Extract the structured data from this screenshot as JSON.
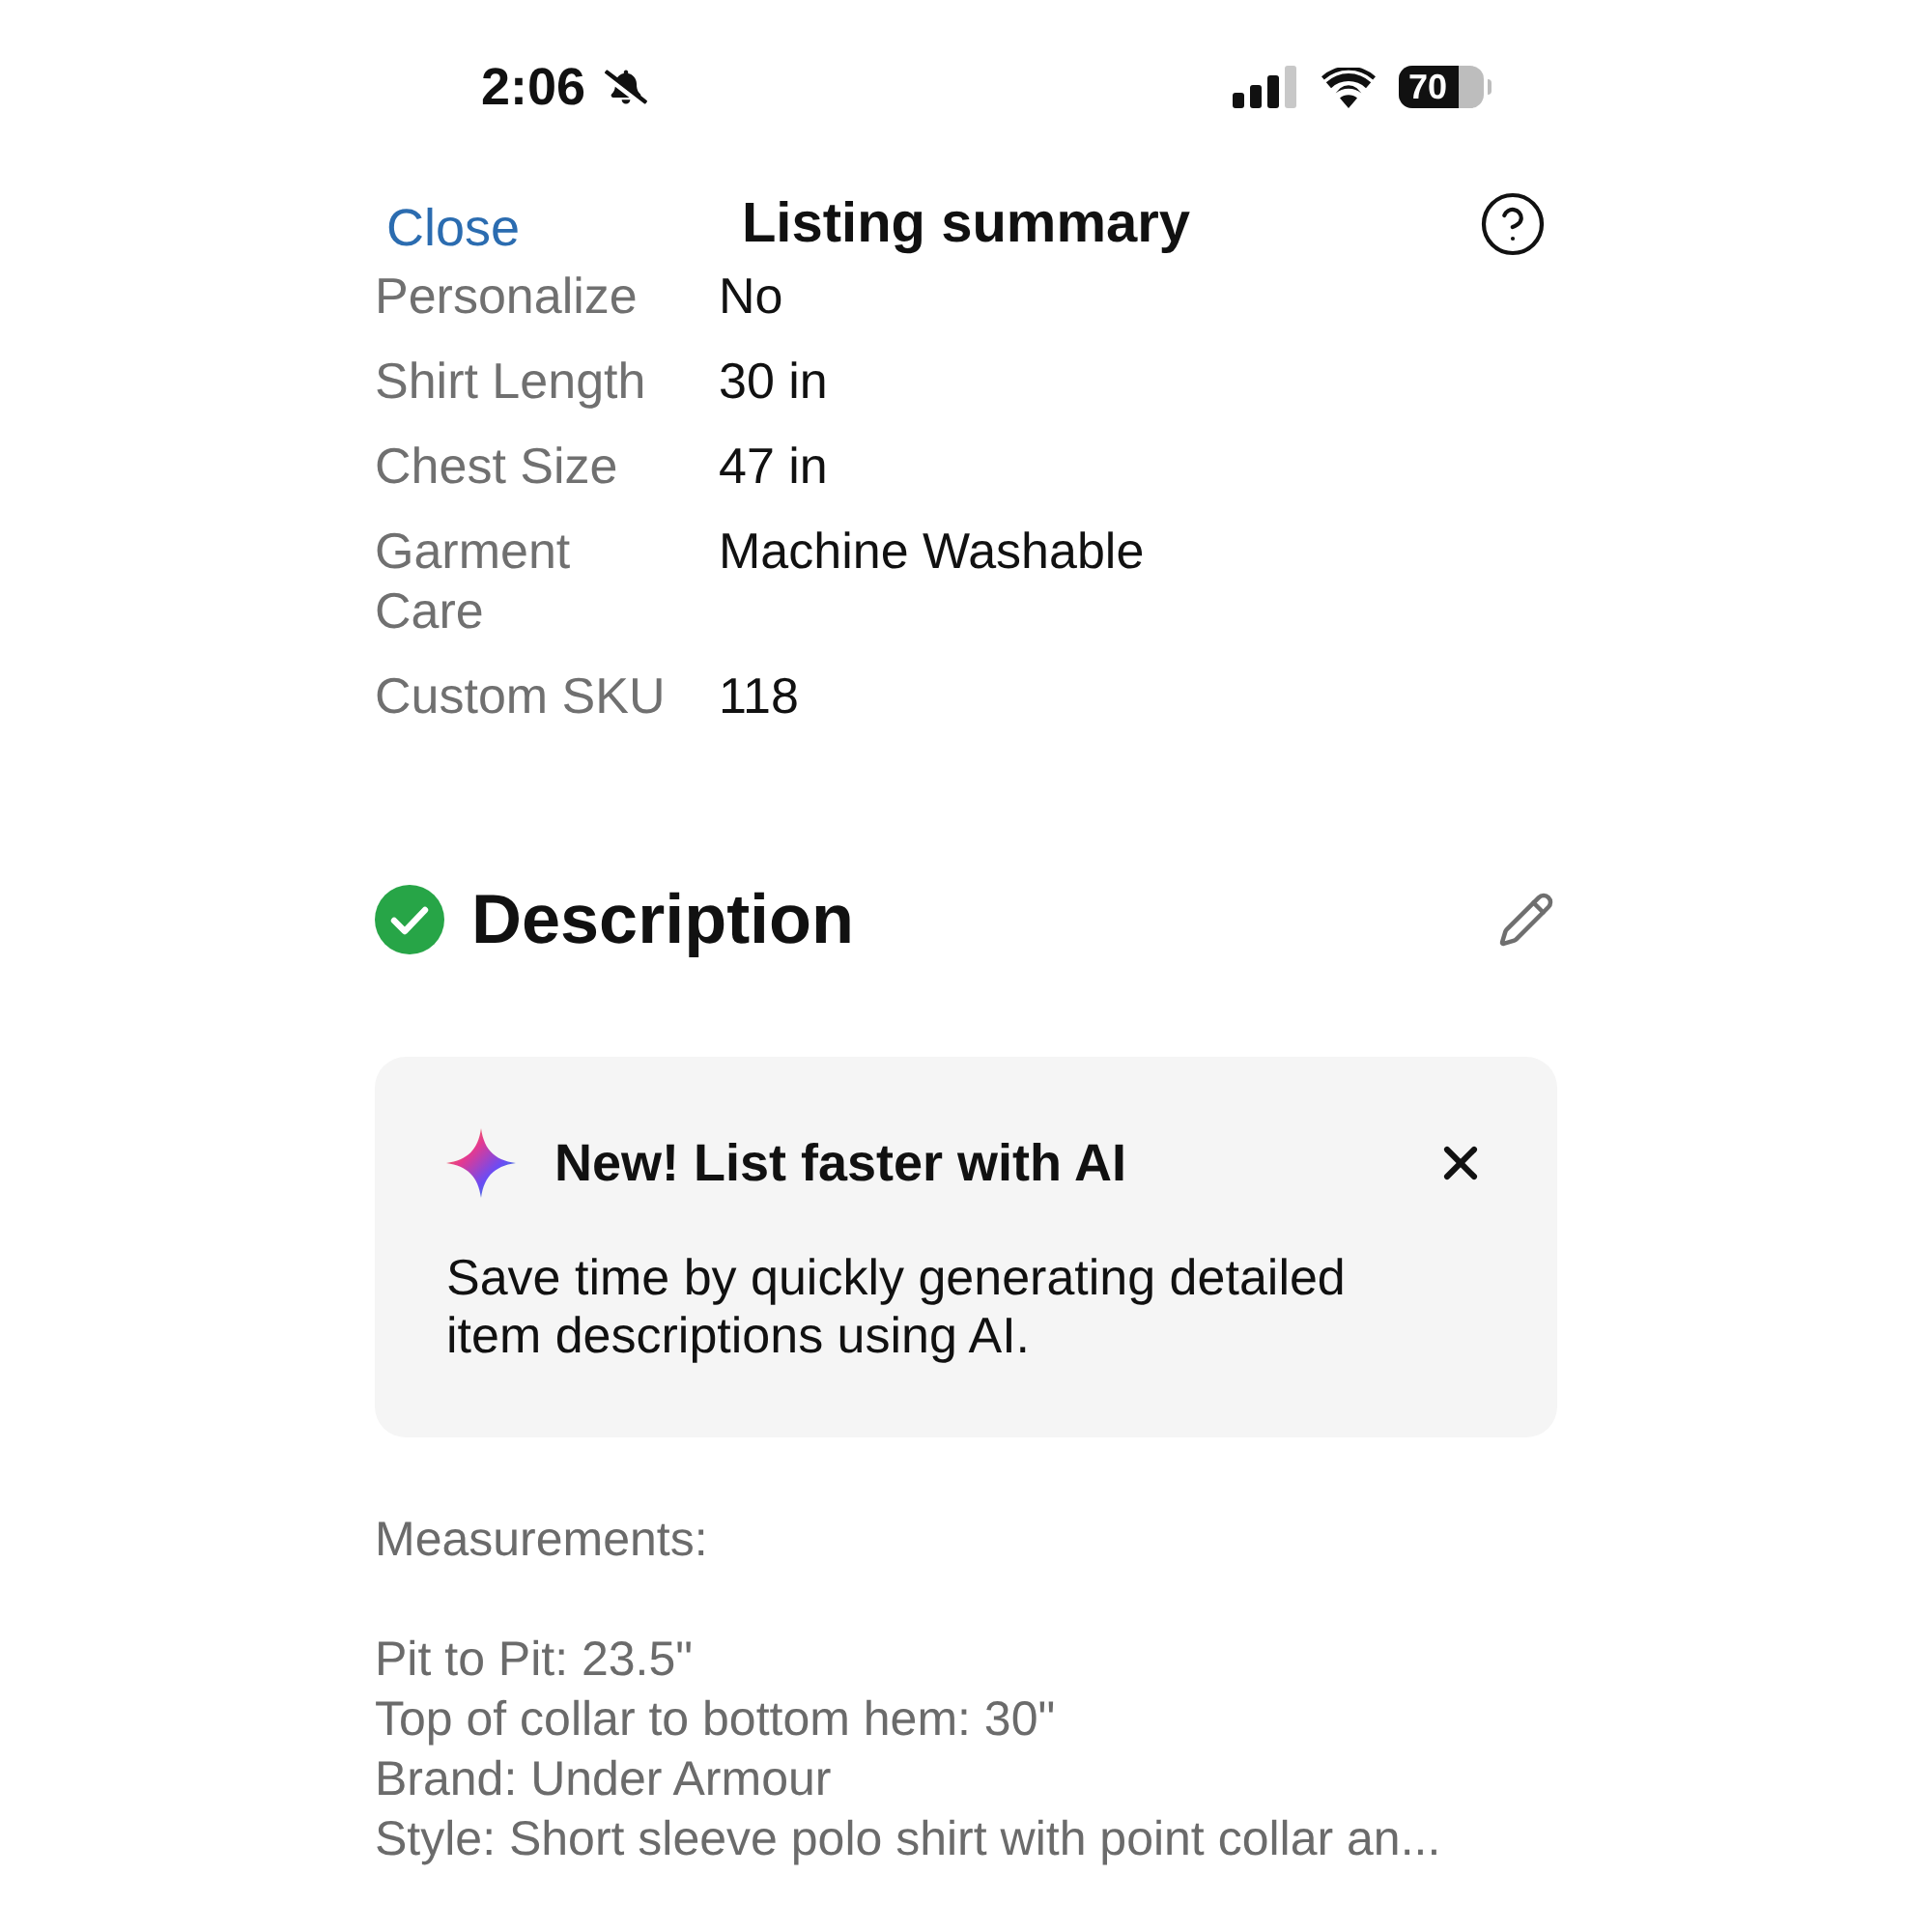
{
  "status_bar": {
    "time": "2:06",
    "battery": "70"
  },
  "header": {
    "close": "Close",
    "title": "Listing summary"
  },
  "item_specifics": [
    {
      "label": "Personalize",
      "value": "No"
    },
    {
      "label": "Shirt Length",
      "value": "30 in"
    },
    {
      "label": "Chest Size",
      "value": "47 in"
    },
    {
      "label": "Garment Care",
      "value": "Machine Washable"
    },
    {
      "label": "Custom SKU",
      "value": "118"
    }
  ],
  "description": {
    "title": "Description",
    "complete": true
  },
  "ai_banner": {
    "title": "New! List faster with AI",
    "body": "Save time by quickly generating detailed item descriptions using AI."
  },
  "description_text": {
    "heading": "Measurements:",
    "lines": [
      "Pit to Pit: 23.5\"",
      "Top of collar to bottom hem: 30\"",
      "Brand: Under Armour",
      "Style: Short sleeve polo shirt with point collar an..."
    ]
  }
}
